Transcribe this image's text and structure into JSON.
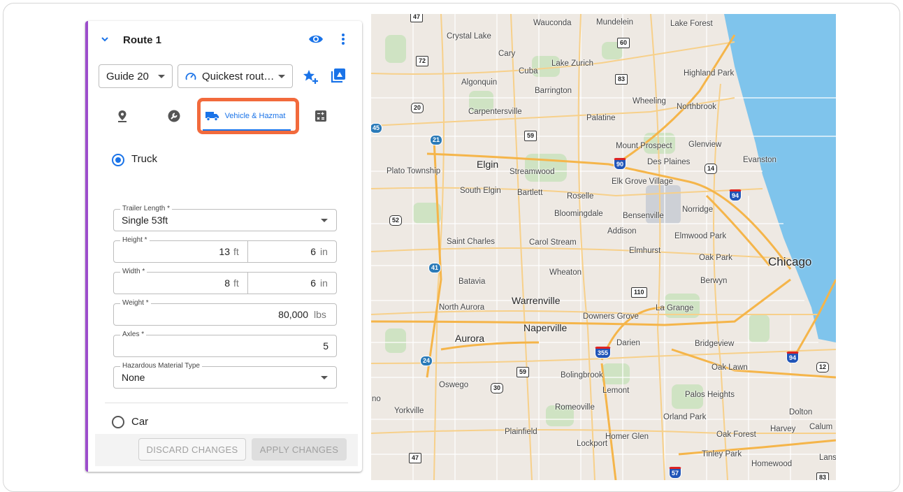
{
  "route": {
    "title": "Route 1"
  },
  "toolbar": {
    "guide_select": "Guide 20",
    "route_type_select": "Quickest rout…"
  },
  "tabs": {
    "vehicle_label": "Vehicle & Hazmat"
  },
  "vehicle": {
    "truck_label": "Truck",
    "car_label": "Car",
    "trailer_length": {
      "label": "Trailer Length *",
      "value": "Single 53ft"
    },
    "height": {
      "label": "Height *",
      "ft": "13",
      "in": "6",
      "ft_unit": "ft",
      "in_unit": "in"
    },
    "width": {
      "label": "Width *",
      "ft": "8",
      "in": "6",
      "ft_unit": "ft",
      "in_unit": "in"
    },
    "weight": {
      "label": "Weight *",
      "value": "80,000",
      "unit": "lbs"
    },
    "axles": {
      "label": "Axles *",
      "value": "5"
    },
    "hazmat": {
      "label": "Hazardous Material Type",
      "value": "None"
    }
  },
  "footer": {
    "discard": "DISCARD CHANGES",
    "apply": "APPLY CHANGES"
  },
  "map": {
    "places": [
      "Wauconda",
      "Mundelein",
      "Lake Forest",
      "Crystal Lake",
      "Cary",
      "Lake Zurich",
      "Highland Park",
      "Cuba",
      "Algonquin",
      "Barrington",
      "Wheeling",
      "Northbrook",
      "Carpentersville",
      "Palatine",
      "Mount Prospect",
      "Glenview",
      "Elgin",
      "Des Plaines",
      "Evanston",
      "Plato Township",
      "Streamwood",
      "Elk Grove Village",
      "South Elgin",
      "Bartlett",
      "Roselle",
      "Bloomingdale",
      "Bensenville",
      "Norridge",
      "Addison",
      "Elmwood Park",
      "Saint Charles",
      "Carol Stream",
      "Elmhurst",
      "Oak Park",
      "Chicago",
      "Wheaton",
      "Batavia",
      "Berwyn",
      "Warrenville",
      "North Aurora",
      "La Grange",
      "Downers Grove",
      "Naperville",
      "Aurora",
      "Darien",
      "Bridgeview",
      "Oak Lawn",
      "Bolingbrook",
      "Lemont",
      "Oswego",
      "Palos Heights",
      "Romeoville",
      "Yorkville",
      "Orland Park",
      "Dolton",
      "Plainfield",
      "Harvey",
      "Calum",
      "Oak Forest",
      "Homer Glen",
      "Lockport",
      "Tinley Park",
      "Homewood",
      "Lans",
      "no"
    ],
    "shields": [
      "47",
      "60",
      "72",
      "83",
      "20",
      "59",
      "21",
      "45",
      "90",
      "14",
      "94",
      "52",
      "41",
      "110",
      "355",
      "24",
      "59",
      "30",
      "94",
      "12",
      "57",
      "47",
      "83"
    ],
    "colors": {
      "land": "#eee9e3",
      "water": "#7fc4ec",
      "highway": "#f5b54a",
      "park": "#cfe3c3"
    }
  }
}
